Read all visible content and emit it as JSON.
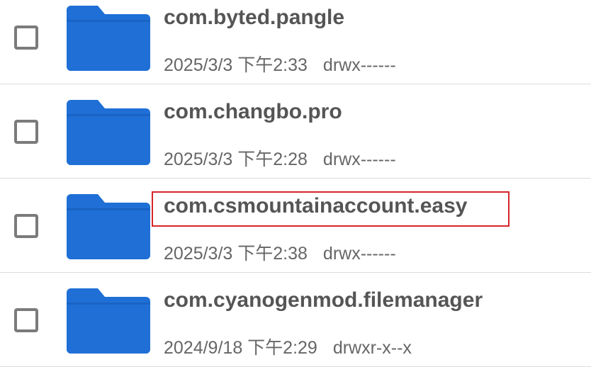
{
  "colors": {
    "folder": "#1f6fd6",
    "folder_tab": "#1a63c4",
    "highlight": "#d6252b",
    "name_text": "#555555",
    "meta_text": "#666666"
  },
  "rows": [
    {
      "name": "com.byted.pangle",
      "date": "2025/3/3 下午2:33",
      "perm": "drwx------",
      "icon": "folder-icon"
    },
    {
      "name": "com.changbo.pro",
      "date": "2025/3/3 下午2:28",
      "perm": "drwx------",
      "icon": "folder-icon"
    },
    {
      "name": "com.csmountainaccount.easy",
      "date": "2025/3/3 下午2:38",
      "perm": "drwx------",
      "icon": "folder-icon",
      "highlighted": true
    },
    {
      "name": "com.cyanogenmod.filemanager",
      "date": "2024/9/18 下午2:29",
      "perm": "drwxr-x--x",
      "icon": "folder-icon"
    }
  ]
}
